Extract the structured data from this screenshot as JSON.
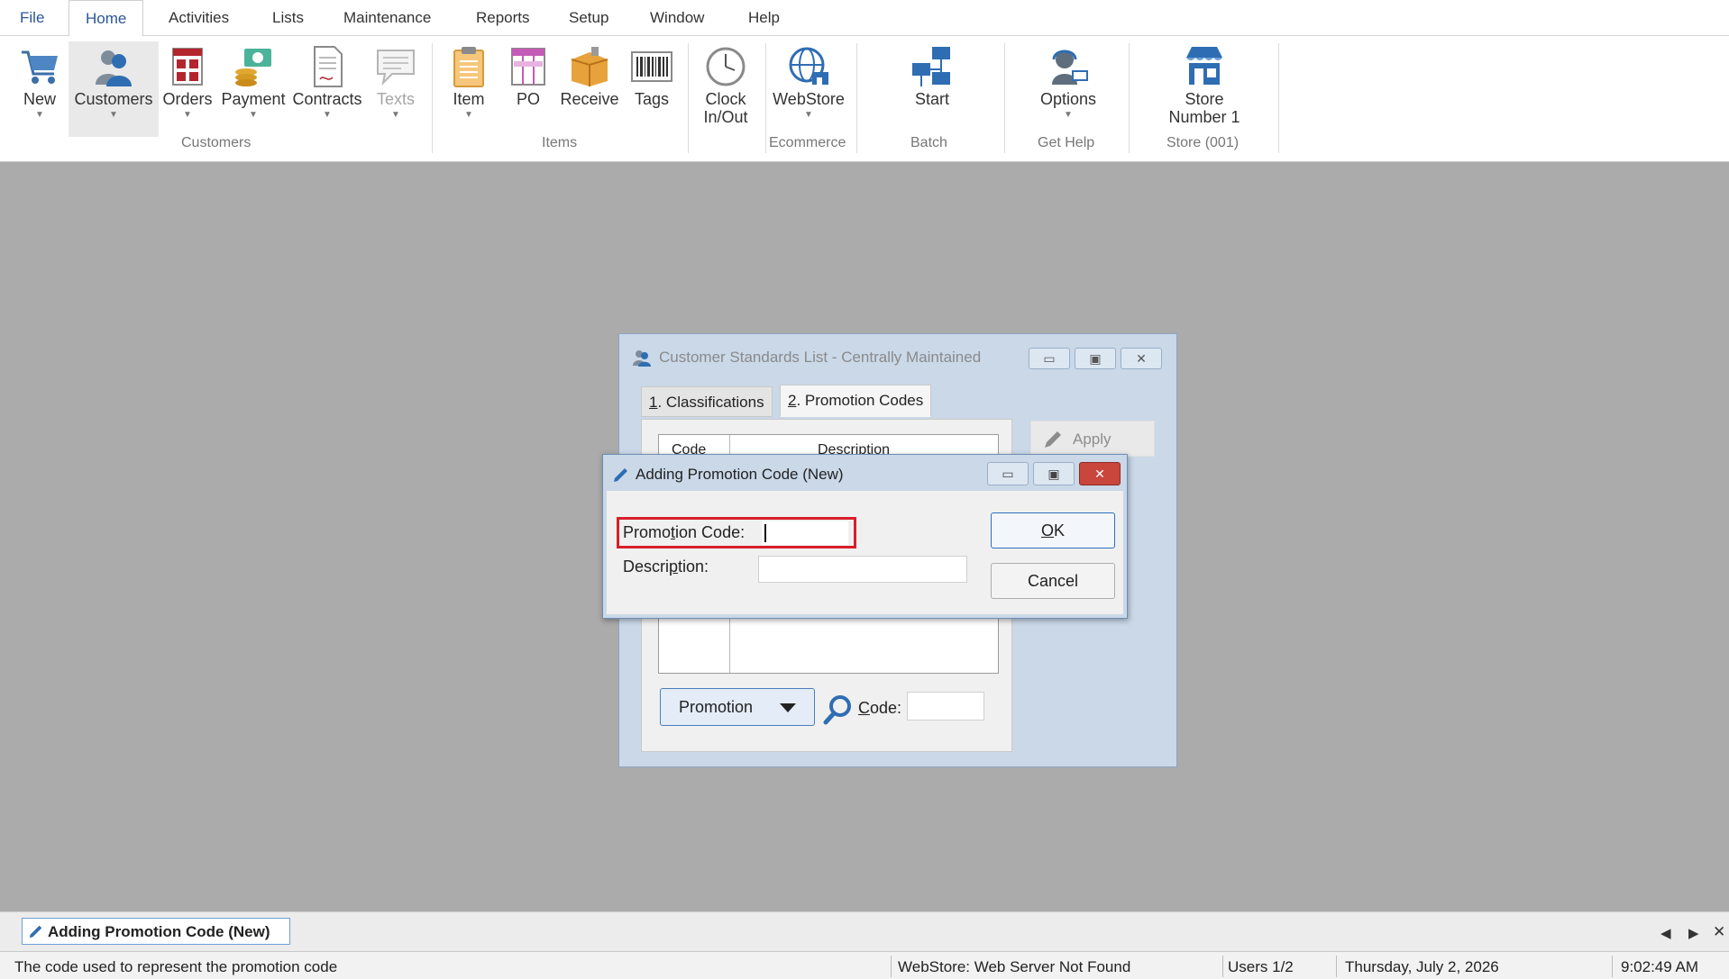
{
  "menu": {
    "items": [
      "File",
      "Home",
      "Activities",
      "Lists",
      "Maintenance",
      "Reports",
      "Setup",
      "Window",
      "Help"
    ],
    "active": "Home"
  },
  "ribbon": {
    "buttons": {
      "new": "New",
      "customers": "Customers",
      "orders": "Orders",
      "payment": "Payment",
      "contracts": "Contracts",
      "texts": "Texts",
      "item": "Item",
      "po": "PO",
      "receive": "Receive",
      "tags": "Tags",
      "clock_line1": "Clock",
      "clock_line2": "In/Out",
      "webstore": "WebStore",
      "start": "Start",
      "options": "Options",
      "store_line1": "Store",
      "store_line2": "Number 1"
    },
    "groups": {
      "customers": "Customers",
      "items": "Items",
      "ecommerce": "Ecommerce",
      "batch": "Batch",
      "get_help": "Get Help",
      "store": "Store (001)"
    }
  },
  "bg_window": {
    "title": "Customer Standards List - Centrally Maintained",
    "tab1_num": "1",
    "tab1_label": ". Classifications",
    "tab2_num": "2",
    "tab2_label": ". Promotion Codes",
    "col_code": "Code",
    "col_description": "Description",
    "apply": "Apply",
    "dropdown": "Promotion",
    "code_label_c": "C",
    "code_label_rest": "ode:"
  },
  "dialog": {
    "title": "Adding Promotion Code  (New)",
    "promotion_code_label_a": "Promo",
    "promotion_code_label_u": "t",
    "promotion_code_label_b": "ion Code:",
    "promotion_code_value": "",
    "description_label_a": "Descri",
    "description_label_u": "p",
    "description_label_b": "tion:",
    "description_value": "",
    "ok_u": "O",
    "ok_rest": "K",
    "cancel": "Cancel"
  },
  "taskbar": {
    "active_task": "Adding Promotion Code  (New)"
  },
  "statusbar": {
    "hint": "The code used to represent the promotion code",
    "webstore": "WebStore: Web Server Not Found",
    "users": "Users 1/2",
    "date": "Thursday, July  2, 2026",
    "time": "9:02:49 AM"
  }
}
